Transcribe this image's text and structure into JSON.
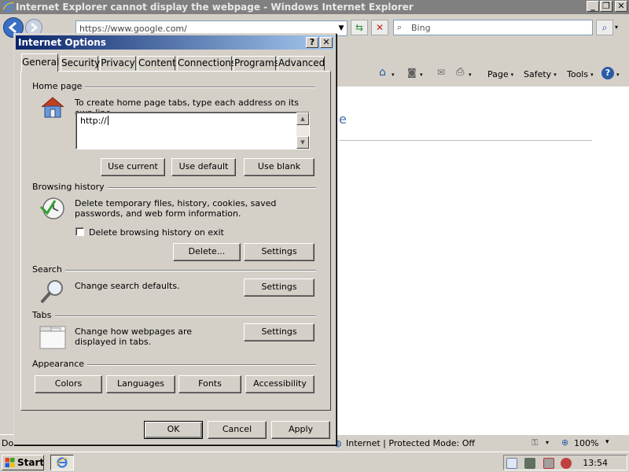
{
  "browser": {
    "title": "Internet Explorer cannot display the webpage - Windows Internet Explorer",
    "address": "https://www.google.com/",
    "search_placeholder": "Bing",
    "caption_buttons": {
      "minimize": "_",
      "restore": "❐",
      "close": "✕"
    },
    "command_bar": [
      "Page",
      "Safety",
      "Tools"
    ],
    "content_peek": "e",
    "status_left": "Do",
    "status_zone": "Internet | Protected Mode: Off",
    "zoom": "100%",
    "zoom_arrow": "▾"
  },
  "taskbar": {
    "start_label": "Start",
    "clock": "13:54"
  },
  "dialog": {
    "title": "Internet Options",
    "help": "?",
    "close": "✕",
    "tabs": [
      "General",
      "Security",
      "Privacy",
      "Content",
      "Connections",
      "Programs",
      "Advanced"
    ],
    "home_page": {
      "heading": "Home page",
      "description": "To create home page tabs, type each address on its own line.",
      "value": "http://",
      "buttons": [
        "Use current",
        "Use default",
        "Use blank"
      ]
    },
    "browsing_history": {
      "heading": "Browsing history",
      "description": "Delete temporary files, history, cookies, saved passwords, and web form information.",
      "checkbox_label": "Delete browsing history on exit",
      "buttons": [
        "Delete...",
        "Settings"
      ]
    },
    "search": {
      "heading": "Search",
      "description": "Change search defaults.",
      "button": "Settings"
    },
    "tabs_section": {
      "heading": "Tabs",
      "description": "Change how webpages are displayed in tabs.",
      "button": "Settings"
    },
    "appearance": {
      "heading": "Appearance",
      "buttons": [
        "Colors",
        "Languages",
        "Fonts",
        "Accessibility"
      ]
    },
    "footer": [
      "OK",
      "Cancel",
      "Apply"
    ]
  },
  "colors": {
    "dialog_title_start": "#0a246a",
    "dialog_title_end": "#a6caf0",
    "face": "#d4d0c8"
  }
}
